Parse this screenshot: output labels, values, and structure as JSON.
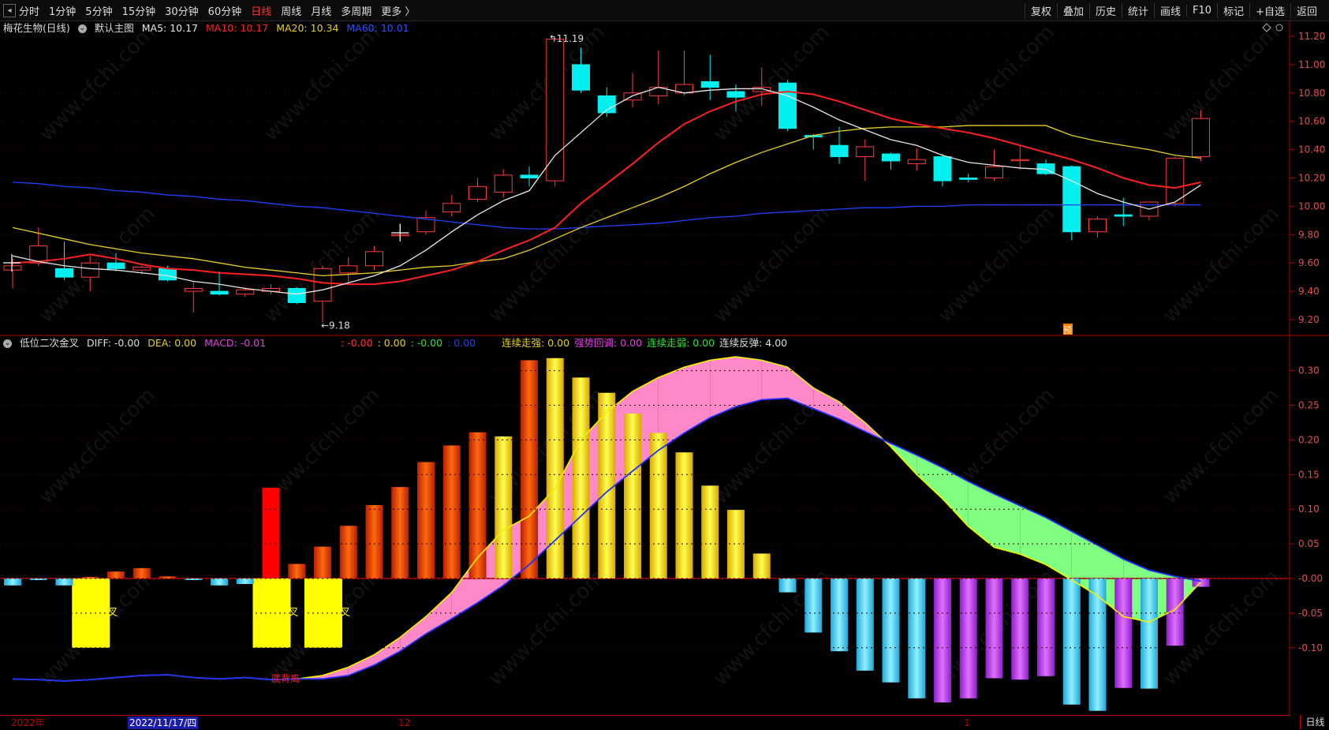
{
  "toolbar": {
    "periods": [
      {
        "label": "分时",
        "active": false
      },
      {
        "label": "1分钟",
        "active": false
      },
      {
        "label": "5分钟",
        "active": false
      },
      {
        "label": "15分钟",
        "active": false
      },
      {
        "label": "30分钟",
        "active": false
      },
      {
        "label": "60分钟",
        "active": false
      },
      {
        "label": "日线",
        "active": true
      },
      {
        "label": "周线",
        "active": false
      },
      {
        "label": "月线",
        "active": false
      },
      {
        "label": "多周期",
        "active": false
      },
      {
        "label": "更多 〉",
        "active": false
      }
    ],
    "tools": [
      "复权",
      "叠加",
      "历史",
      "统计",
      "画线",
      "F10",
      "标记",
      "+自选",
      "返回"
    ]
  },
  "main_chart": {
    "stock_title": "梅花生物(日线)",
    "template_label": "默认主图",
    "ma5": {
      "label": "MA5: 10.17",
      "color": "#e8e8e8"
    },
    "ma10": {
      "label": "MA10: 10.17",
      "color": "#ff2020"
    },
    "ma20": {
      "label": "MA20: 10.34",
      "color": "#e8d020"
    },
    "ma60": {
      "label": "MA60: 10.01",
      "color": "#2040ff"
    },
    "high_marker": "11.19",
    "low_marker": "9.18",
    "pre_marker": "预",
    "y_ticks": [
      "11.20",
      "11.00",
      "10.80",
      "10.60",
      "10.40",
      "10.20",
      "10.00",
      "9.80",
      "9.60",
      "9.40",
      "9.20"
    ]
  },
  "indicator": {
    "name": "低位二次金叉",
    "diff": "DIFF: -0.00",
    "dea": "DEA: 0.00",
    "macd": "MACD: -0.01",
    "extras": [
      {
        "text": ": -0.00",
        "color": "#ff3030"
      },
      {
        "text": ": 0.00",
        "color": "#e8d020"
      },
      {
        "text": ": -0.00",
        "color": "#30e030"
      },
      {
        "text": ": 0.00",
        "color": "#2040ff"
      }
    ],
    "states": [
      {
        "text": "连续走强: 0.00",
        "color": "#e8d020"
      },
      {
        "text": "强势回调: 0.00",
        "color": "#e040e0"
      },
      {
        "text": "连续走弱: 0.00",
        "color": "#30e030"
      },
      {
        "text": "连续反弹: 4.00",
        "color": "#dddddd"
      }
    ],
    "signal_labels": [
      "金叉",
      "金叉",
      "金叉"
    ],
    "bottom_signal": "底背离",
    "y_ticks": [
      "0.30",
      "0.25",
      "0.20",
      "0.15",
      "0.10",
      "0.05",
      "-0.00",
      "-0.05",
      "-0.10"
    ]
  },
  "bottom": {
    "year_label": "2022年",
    "cursor_date": "2022/11/17/四",
    "month_12": "12",
    "month_1": "1",
    "period_label": "日线"
  },
  "watermark": "www.cfchi.com",
  "chart_data": {
    "type": "candlestick",
    "candles": [
      [
        9.55,
        9.58,
        9.42,
        9.63
      ],
      [
        9.6,
        9.72,
        9.58,
        9.85
      ],
      [
        9.56,
        9.5,
        9.48,
        9.75
      ],
      [
        9.5,
        9.6,
        9.4,
        9.65
      ],
      [
        9.6,
        9.56,
        9.54,
        9.67
      ],
      [
        9.55,
        9.57,
        9.52,
        9.58
      ],
      [
        9.56,
        9.48,
        9.47,
        9.58
      ],
      [
        9.4,
        9.42,
        9.25,
        9.47
      ],
      [
        9.4,
        9.38,
        9.37,
        9.54
      ],
      [
        9.38,
        9.41,
        9.36,
        9.43
      ],
      [
        9.4,
        9.42,
        9.38,
        9.45
      ],
      [
        9.42,
        9.32,
        9.31,
        9.43
      ],
      [
        9.33,
        9.56,
        9.18,
        9.58
      ],
      [
        9.53,
        9.58,
        9.45,
        9.64
      ],
      [
        9.58,
        9.68,
        9.55,
        9.72
      ],
      [
        9.8,
        9.8,
        9.78,
        9.88
      ],
      [
        9.82,
        9.92,
        9.8,
        9.97
      ],
      [
        9.96,
        10.02,
        9.93,
        10.08
      ],
      [
        10.05,
        10.14,
        10.03,
        10.2
      ],
      [
        10.1,
        10.22,
        10.06,
        10.26
      ],
      [
        10.22,
        10.2,
        10.14,
        10.28
      ],
      [
        10.18,
        11.18,
        10.14,
        11.19
      ],
      [
        11.0,
        10.82,
        10.8,
        11.12
      ],
      [
        10.78,
        10.66,
        10.63,
        10.84
      ],
      [
        10.75,
        10.8,
        10.7,
        10.94
      ],
      [
        10.78,
        10.84,
        10.72,
        11.1
      ],
      [
        10.8,
        10.86,
        10.78,
        11.1
      ],
      [
        10.88,
        10.84,
        10.75,
        11.07
      ],
      [
        10.81,
        10.77,
        10.67,
        10.86
      ],
      [
        10.81,
        10.84,
        10.71,
        10.98
      ],
      [
        10.87,
        10.55,
        10.53,
        10.89
      ],
      [
        10.5,
        10.49,
        10.4,
        10.51
      ],
      [
        10.43,
        10.35,
        10.3,
        10.56
      ],
      [
        10.35,
        10.42,
        10.18,
        10.47
      ],
      [
        10.37,
        10.32,
        10.26,
        10.38
      ],
      [
        10.3,
        10.33,
        10.25,
        10.41
      ],
      [
        10.35,
        10.18,
        10.14,
        10.37
      ],
      [
        10.2,
        10.19,
        10.17,
        10.23
      ],
      [
        10.2,
        10.28,
        10.18,
        10.4
      ],
      [
        10.33,
        10.33,
        10.26,
        10.43
      ],
      [
        10.3,
        10.23,
        10.22,
        10.33
      ],
      [
        10.28,
        9.82,
        9.76,
        10.29
      ],
      [
        9.82,
        9.91,
        9.78,
        9.93
      ],
      [
        9.94,
        9.93,
        9.86,
        10.06
      ],
      [
        9.93,
        10.03,
        9.9,
        10.03
      ],
      [
        10.02,
        10.34,
        10.0,
        10.35
      ],
      [
        10.35,
        10.62,
        10.32,
        10.68
      ]
    ],
    "ma5": [
      9.65,
      9.61,
      9.58,
      9.56,
      9.55,
      9.53,
      9.51,
      9.47,
      9.45,
      9.42,
      9.4,
      9.38,
      9.41,
      9.46,
      9.51,
      9.58,
      9.69,
      9.82,
      9.94,
      10.04,
      10.11,
      10.36,
      10.52,
      10.68,
      10.78,
      10.84,
      10.8,
      10.82,
      10.83,
      10.83,
      10.78,
      10.7,
      10.61,
      10.54,
      10.47,
      10.43,
      10.36,
      10.31,
      10.29,
      10.27,
      10.26,
      10.18,
      10.09,
      10.03,
      9.98,
      10.03,
      10.15
    ],
    "ma10": [
      9.6,
      9.61,
      9.63,
      9.66,
      9.63,
      9.59,
      9.56,
      9.55,
      9.53,
      9.52,
      9.51,
      9.49,
      9.46,
      9.45,
      9.45,
      9.47,
      9.51,
      9.55,
      9.61,
      9.69,
      9.76,
      9.85,
      10.02,
      10.16,
      10.3,
      10.45,
      10.58,
      10.67,
      10.74,
      10.79,
      10.81,
      10.79,
      10.74,
      10.68,
      10.62,
      10.58,
      10.55,
      10.52,
      10.48,
      10.43,
      10.38,
      10.33,
      10.27,
      10.2,
      10.15,
      10.13,
      10.17
    ],
    "ma20": [
      9.85,
      9.81,
      9.77,
      9.73,
      9.7,
      9.67,
      9.65,
      9.63,
      9.6,
      9.57,
      9.55,
      9.53,
      9.51,
      9.52,
      9.53,
      9.55,
      9.57,
      9.58,
      9.61,
      9.63,
      9.69,
      9.77,
      9.85,
      9.92,
      9.99,
      10.06,
      10.14,
      10.23,
      10.31,
      10.38,
      10.44,
      10.5,
      10.53,
      10.55,
      10.56,
      10.56,
      10.56,
      10.57,
      10.57,
      10.57,
      10.57,
      10.5,
      10.46,
      10.43,
      10.4,
      10.36,
      10.34
    ],
    "ma60": [
      10.17,
      10.16,
      10.14,
      10.13,
      10.11,
      10.1,
      10.08,
      10.07,
      10.05,
      10.04,
      10.02,
      10.0,
      9.99,
      9.97,
      9.95,
      9.93,
      9.91,
      9.89,
      9.87,
      9.85,
      9.84,
      9.84,
      9.85,
      9.86,
      9.87,
      9.88,
      9.9,
      9.92,
      9.93,
      9.95,
      9.96,
      9.97,
      9.98,
      9.99,
      9.99,
      10.0,
      10.0,
      10.01,
      10.01,
      10.01,
      10.01,
      10.01,
      10.01,
      10.01,
      10.01,
      10.01,
      10.01
    ],
    "macd_bars": [
      -0.01,
      -0.001,
      -0.01,
      0.002,
      0.01,
      0.015,
      0.003,
      -0.001,
      -0.01,
      -0.008,
      0.131,
      0.021,
      0.046,
      0.076,
      0.106,
      0.132,
      0.168,
      0.192,
      0.211,
      0.205,
      0.315,
      0.318,
      0.29,
      0.268,
      0.238,
      0.21,
      0.182,
      0.134,
      0.099,
      0.036,
      -0.02,
      -0.078,
      -0.105,
      -0.133,
      -0.15,
      -0.173,
      -0.179,
      -0.173,
      -0.144,
      -0.146,
      -0.141,
      -0.182,
      -0.191,
      -0.158,
      -0.159,
      -0.097,
      -0.012
    ],
    "diff": [
      -0.145,
      -0.146,
      -0.148,
      -0.146,
      -0.143,
      -0.14,
      -0.139,
      -0.143,
      -0.145,
      -0.143,
      -0.146,
      -0.145,
      -0.14,
      -0.128,
      -0.11,
      -0.085,
      -0.055,
      -0.02,
      0.03,
      0.07,
      0.09,
      0.13,
      0.2,
      0.24,
      0.27,
      0.29,
      0.305,
      0.315,
      0.32,
      0.315,
      0.305,
      0.275,
      0.255,
      0.225,
      0.19,
      0.15,
      0.115,
      0.075,
      0.045,
      0.035,
      0.02,
      -0.002,
      -0.025,
      -0.055,
      -0.063,
      -0.045,
      -0.005
    ],
    "dea": [
      -0.145,
      -0.146,
      -0.148,
      -0.146,
      -0.143,
      -0.14,
      -0.139,
      -0.143,
      -0.145,
      -0.143,
      -0.146,
      -0.145,
      -0.145,
      -0.14,
      -0.125,
      -0.105,
      -0.08,
      -0.058,
      -0.035,
      -0.01,
      0.02,
      0.055,
      0.09,
      0.125,
      0.155,
      0.185,
      0.21,
      0.232,
      0.248,
      0.258,
      0.26,
      0.245,
      0.23,
      0.212,
      0.195,
      0.178,
      0.16,
      0.14,
      0.122,
      0.105,
      0.088,
      0.068,
      0.048,
      0.028,
      0.012,
      0.003,
      -0.004
    ],
    "golden_cross_markers": [
      {
        "index": 3,
        "value": -0.1
      },
      {
        "index": 10,
        "value": -0.1
      },
      {
        "index": 12,
        "value": -0.1
      }
    ]
  }
}
